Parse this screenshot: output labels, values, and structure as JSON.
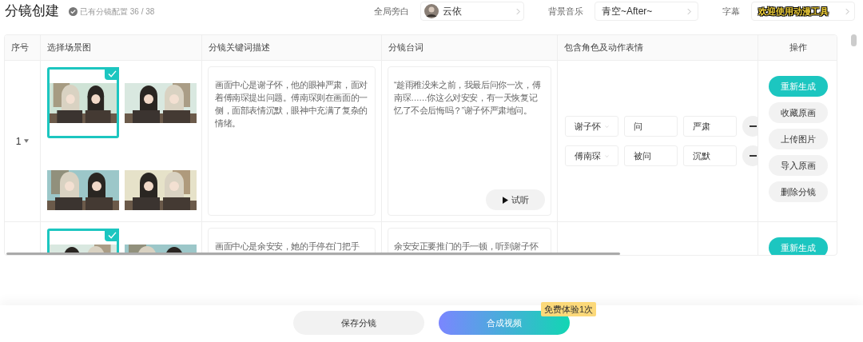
{
  "header": {
    "title": "分镜创建",
    "config_status": "已有分镜配置 36 / 38",
    "narration": {
      "label": "全局旁白",
      "value": "云依"
    },
    "music": {
      "label": "背景音乐",
      "value": "青空~After~"
    },
    "subtitle": {
      "label": "字幕",
      "value": "欢迎使用动漫工具"
    }
  },
  "table": {
    "columns": [
      "序号",
      "选择场景图",
      "分镜关键词描述",
      "分镜台词",
      "包含角色及动作表情",
      "操作"
    ],
    "rows": [
      {
        "index": "1",
        "images": [
          {
            "selected": true
          },
          {
            "selected": false
          },
          {
            "selected": false
          },
          {
            "selected": false
          }
        ],
        "description": "画面中心是谢子怀，他的眼神严肃，面对着傅南琛提出问题。傅南琛则在画面的一侧，面部表情沉默，眼神中充满了复杂的情绪。",
        "dialogue": "“趁雨稚没来之前，我最后问你一次，傅南琛……你这么对安安，有一天恢复记忆了不会后悔吗？”谢子怀严肃地问。",
        "listen_button": "试听",
        "roles": [
          {
            "name": "谢子怀",
            "action": "问",
            "expression": "严肃"
          },
          {
            "name": "傅南琛",
            "action": "被问",
            "expression": "沉默"
          }
        ],
        "actions": [
          {
            "label": "重新生成",
            "kind": "primary"
          },
          {
            "label": "收藏原画",
            "kind": "secondary"
          },
          {
            "label": "上传图片",
            "kind": "secondary"
          },
          {
            "label": "导入原画",
            "kind": "secondary"
          },
          {
            "label": "删除分镜",
            "kind": "secondary"
          }
        ]
      },
      {
        "images": [
          {
            "selected": true
          },
          {
            "selected": false
          }
        ],
        "description": "画面中心是余安安，她的手停在门把手",
        "dialogue": "余安安正要推门的手一顿，听到谢子怀",
        "roles": [],
        "actions": [
          {
            "label": "重新生成",
            "kind": "primary"
          }
        ]
      }
    ]
  },
  "footer": {
    "buttons": [
      {
        "label": "保存分镜",
        "kind": "secondary"
      },
      {
        "label": "合成视频",
        "kind": "primary"
      }
    ],
    "badge": "免费体验1次"
  }
}
